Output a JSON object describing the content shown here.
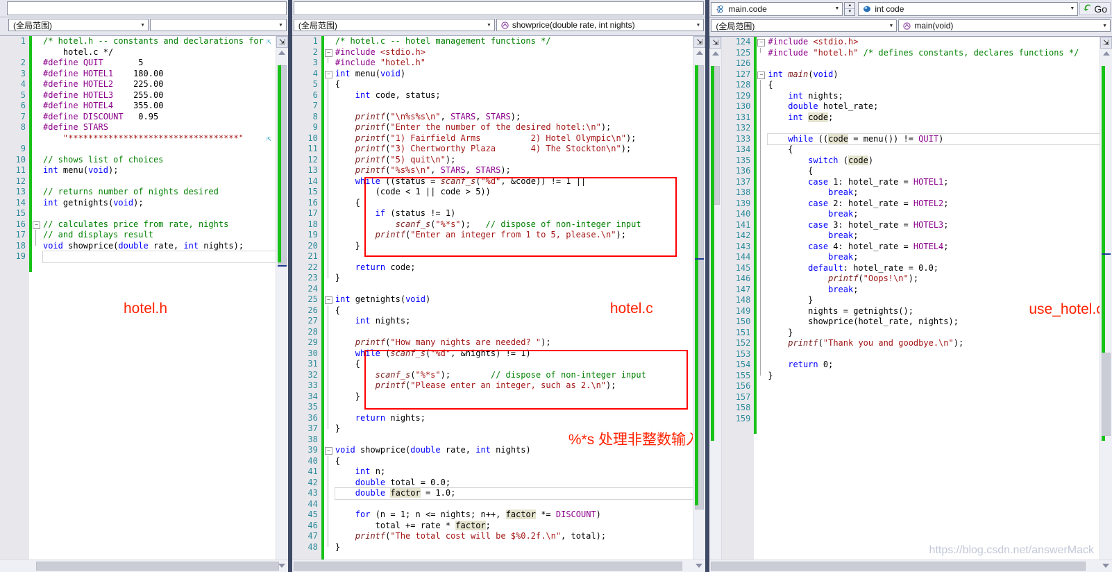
{
  "window": {
    "accent": "#3f4a66",
    "annotation_color": "#ff2200",
    "changebar_color": "#19c219",
    "watermark": "https://blog.csdn.net/answerMack"
  },
  "panes": [
    {
      "id": "hotel-h",
      "annotation": "hotel.h",
      "scope_combo": {
        "value": "(全局范围)",
        "icon": "none"
      },
      "member_combo": {
        "value": "",
        "icon": "none"
      },
      "first_line": 1,
      "lines": [
        {
          "n": 1,
          "text": "/* hotel.h -- constants and declarations for",
          "kind": "cmt",
          "fold": "none"
        },
        {
          "n": "",
          "text": "    hotel.c */",
          "kind": "cmt",
          "fold": "none"
        },
        {
          "n": 2,
          "text": "#define QUIT       5",
          "kind": "pp",
          "fold": "none"
        },
        {
          "n": 3,
          "text": "#define HOTEL1    180.00",
          "kind": "pp",
          "fold": "none"
        },
        {
          "n": 4,
          "text": "#define HOTEL2    225.00",
          "kind": "pp",
          "fold": "none"
        },
        {
          "n": 5,
          "text": "#define HOTEL3    255.00",
          "kind": "pp",
          "fold": "none"
        },
        {
          "n": 6,
          "text": "#define HOTEL4    355.00",
          "kind": "pp",
          "fold": "none"
        },
        {
          "n": 7,
          "text": "#define DISCOUNT   0.95",
          "kind": "pp",
          "fold": "none"
        },
        {
          "n": 8,
          "text": "#define STARS",
          "kind": "pp",
          "fold": "none"
        },
        {
          "n": "",
          "text": "    \"**********************************\"",
          "kind": "str",
          "fold": "none"
        },
        {
          "n": 9,
          "text": "",
          "kind": "plain",
          "fold": "none"
        },
        {
          "n": 10,
          "text": "// shows list of choices",
          "kind": "cmt",
          "fold": "none"
        },
        {
          "n": 11,
          "text": "int menu(void);",
          "kind": "decl",
          "fold": "none"
        },
        {
          "n": 12,
          "text": "",
          "kind": "plain",
          "fold": "none"
        },
        {
          "n": 13,
          "text": "// returns number of nights desired",
          "kind": "cmt",
          "fold": "none"
        },
        {
          "n": 14,
          "text": "int getnights(void);",
          "kind": "decl",
          "fold": "none"
        },
        {
          "n": 15,
          "text": "",
          "kind": "plain",
          "fold": "none"
        },
        {
          "n": 16,
          "text": "// calculates price from rate, nights",
          "kind": "cmt",
          "fold": "minus"
        },
        {
          "n": 17,
          "text": "// and displays result",
          "kind": "cmt",
          "fold": "bar"
        },
        {
          "n": 18,
          "text": "void showprice(double rate, int nights);",
          "kind": "decl",
          "fold": "end"
        },
        {
          "n": 19,
          "text": "",
          "kind": "plain",
          "fold": "none",
          "current": true
        }
      ]
    },
    {
      "id": "hotel-c",
      "annotation": "hotel.c",
      "annotation2": "%*s  处理非整数输入",
      "scope_combo": {
        "value": "(全局范围)",
        "icon": "none"
      },
      "member_combo": {
        "value": "showprice(double rate, int nights)",
        "icon": "method-icon"
      },
      "first_line": 1,
      "lines": [
        {
          "n": 1,
          "text": "/* hotel.c -- hotel management functions */",
          "kind": "cmt"
        },
        {
          "n": 2,
          "text": "#include <stdio.h>",
          "kind": "pp",
          "fold": "minus"
        },
        {
          "n": 3,
          "text": "#include \"hotel.h\"",
          "kind": "ppstr",
          "fold": "end"
        },
        {
          "n": 4,
          "text": "int menu(void)",
          "kind": "decl",
          "fold": "minus"
        },
        {
          "n": 5,
          "text": "{",
          "kind": "plain",
          "fold": "bar"
        },
        {
          "n": 6,
          "text": "    int code, status;",
          "kind": "decl",
          "fold": "bar"
        },
        {
          "n": 7,
          "text": "",
          "kind": "plain",
          "fold": "bar"
        },
        {
          "n": 8,
          "text": "    printf(\"\\n%s%s\\n\", STARS, STARS);",
          "kind": "call",
          "fold": "bar"
        },
        {
          "n": 9,
          "text": "    printf(\"Enter the number of the desired hotel:\\n\");",
          "kind": "call",
          "fold": "bar"
        },
        {
          "n": 10,
          "text": "    printf(\"1) Fairfield Arms          2) Hotel Olympic\\n\");",
          "kind": "call",
          "fold": "bar"
        },
        {
          "n": 11,
          "text": "    printf(\"3) Chertworthy Plaza       4) The Stockton\\n\");",
          "kind": "call",
          "fold": "bar"
        },
        {
          "n": 12,
          "text": "    printf(\"5) quit\\n\");",
          "kind": "call",
          "fold": "bar"
        },
        {
          "n": 13,
          "text": "    printf(\"%s%s\\n\", STARS, STARS);",
          "kind": "call",
          "fold": "bar"
        },
        {
          "n": 14,
          "text": "    while ((status = scanf_s(\"%d\", &code)) != 1 ||",
          "kind": "ctrl",
          "fold": "bar"
        },
        {
          "n": 15,
          "text": "        (code < 1 || code > 5))",
          "kind": "plain",
          "fold": "bar"
        },
        {
          "n": 16,
          "text": "    {",
          "kind": "plain",
          "fold": "bar"
        },
        {
          "n": 17,
          "text": "        if (status != 1)",
          "kind": "ctrl",
          "fold": "bar"
        },
        {
          "n": 18,
          "text": "            scanf_s(\"%*s\");   // dispose of non-integer input",
          "kind": "callcmt",
          "fold": "bar"
        },
        {
          "n": 19,
          "text": "        printf(\"Enter an integer from 1 to 5, please.\\n\");",
          "kind": "call",
          "fold": "bar"
        },
        {
          "n": 20,
          "text": "    }",
          "kind": "plain",
          "fold": "bar"
        },
        {
          "n": 21,
          "text": "",
          "kind": "plain",
          "fold": "bar"
        },
        {
          "n": 22,
          "text": "    return code;",
          "kind": "ctrl",
          "fold": "bar"
        },
        {
          "n": 23,
          "text": "}",
          "kind": "plain",
          "fold": "end"
        },
        {
          "n": 24,
          "text": "",
          "kind": "plain"
        },
        {
          "n": 25,
          "text": "int getnights(void)",
          "kind": "decl",
          "fold": "minus"
        },
        {
          "n": 26,
          "text": "{",
          "kind": "plain",
          "fold": "bar"
        },
        {
          "n": 27,
          "text": "    int nights;",
          "kind": "decl",
          "fold": "bar"
        },
        {
          "n": 28,
          "text": "",
          "kind": "plain",
          "fold": "bar"
        },
        {
          "n": 29,
          "text": "    printf(\"How many nights are needed? \");",
          "kind": "call",
          "fold": "bar"
        },
        {
          "n": 30,
          "text": "    while (scanf_s(\"%d\", &nights) != 1)",
          "kind": "ctrl",
          "fold": "bar"
        },
        {
          "n": 31,
          "text": "    {",
          "kind": "plain",
          "fold": "bar"
        },
        {
          "n": 32,
          "text": "        scanf_s(\"%*s\");        // dispose of non-integer input",
          "kind": "callcmt",
          "fold": "bar"
        },
        {
          "n": 33,
          "text": "        printf(\"Please enter an integer, such as 2.\\n\");",
          "kind": "call",
          "fold": "bar"
        },
        {
          "n": 34,
          "text": "    }",
          "kind": "plain",
          "fold": "bar"
        },
        {
          "n": 35,
          "text": "",
          "kind": "plain",
          "fold": "bar"
        },
        {
          "n": 36,
          "text": "    return nights;",
          "kind": "ctrl",
          "fold": "bar"
        },
        {
          "n": 37,
          "text": "}",
          "kind": "plain",
          "fold": "end"
        },
        {
          "n": 38,
          "text": "",
          "kind": "plain"
        },
        {
          "n": 39,
          "text": "void showprice(double rate, int nights)",
          "kind": "decl",
          "fold": "minus"
        },
        {
          "n": 40,
          "text": "{",
          "kind": "plain",
          "fold": "bar"
        },
        {
          "n": 41,
          "text": "    int n;",
          "kind": "decl",
          "fold": "bar"
        },
        {
          "n": 42,
          "text": "    double total = 0.0;",
          "kind": "decl",
          "fold": "bar"
        },
        {
          "n": 43,
          "text": "    double factor = 1.0;",
          "kind": "decl",
          "fold": "bar",
          "current": true
        },
        {
          "n": 44,
          "text": "",
          "kind": "plain",
          "fold": "bar"
        },
        {
          "n": 45,
          "text": "    for (n = 1; n <= nights; n++, factor *= DISCOUNT)",
          "kind": "ctrl",
          "fold": "bar"
        },
        {
          "n": 46,
          "text": "        total += rate * factor;",
          "kind": "plain",
          "fold": "bar"
        },
        {
          "n": 47,
          "text": "    printf(\"The total cost will be $%0.2f.\\n\", total);",
          "kind": "call",
          "fold": "bar"
        },
        {
          "n": 48,
          "text": "}",
          "kind": "plain",
          "fold": "end"
        }
      ]
    },
    {
      "id": "use-hotel-c",
      "annotation": "use_hotel.c",
      "file_combo": {
        "value": "main.code",
        "icon": "code-file-icon"
      },
      "symbol_combo": {
        "value": "int code",
        "icon": "field-icon"
      },
      "go_button": {
        "label": "Go",
        "icon": "go-arrow-icon"
      },
      "scope_combo": {
        "value": "(全局范围)",
        "icon": "none"
      },
      "member_combo": {
        "value": "main(void)",
        "icon": "method-icon"
      },
      "first_line": 124,
      "lines": [
        {
          "n": 124,
          "text": "#include <stdio.h>",
          "kind": "pp",
          "fold": "minus"
        },
        {
          "n": 125,
          "text": "#include \"hotel.h\" /* defines constants, declares functions */",
          "kind": "ppstrcmt",
          "fold": "end"
        },
        {
          "n": 126,
          "text": "",
          "kind": "plain"
        },
        {
          "n": 127,
          "text": "int main(void)",
          "kind": "declmain",
          "fold": "minus"
        },
        {
          "n": 128,
          "text": "{",
          "kind": "plain",
          "fold": "bar"
        },
        {
          "n": 129,
          "text": "    int nights;",
          "kind": "decl",
          "fold": "bar"
        },
        {
          "n": 130,
          "text": "    double hotel_rate;",
          "kind": "decl",
          "fold": "bar"
        },
        {
          "n": 131,
          "text": "    int code;",
          "kind": "declhl",
          "fold": "bar"
        },
        {
          "n": 132,
          "text": "",
          "kind": "plain",
          "fold": "bar"
        },
        {
          "n": 133,
          "text": "    while ((code = menu()) != QUIT)",
          "kind": "ctrlhl",
          "fold": "bar",
          "current": true
        },
        {
          "n": 134,
          "text": "    {",
          "kind": "plain",
          "fold": "bar"
        },
        {
          "n": 135,
          "text": "        switch (code)",
          "kind": "ctrlhl2",
          "fold": "bar"
        },
        {
          "n": 136,
          "text": "        {",
          "kind": "plain",
          "fold": "bar"
        },
        {
          "n": 137,
          "text": "        case 1: hotel_rate = HOTEL1;",
          "kind": "case",
          "fold": "bar"
        },
        {
          "n": 138,
          "text": "            break;",
          "kind": "ctrl",
          "fold": "bar"
        },
        {
          "n": 139,
          "text": "        case 2: hotel_rate = HOTEL2;",
          "kind": "case",
          "fold": "bar"
        },
        {
          "n": 140,
          "text": "            break;",
          "kind": "ctrl",
          "fold": "bar"
        },
        {
          "n": 141,
          "text": "        case 3: hotel_rate = HOTEL3;",
          "kind": "case",
          "fold": "bar"
        },
        {
          "n": 142,
          "text": "            break;",
          "kind": "ctrl",
          "fold": "bar"
        },
        {
          "n": 143,
          "text": "        case 4: hotel_rate = HOTEL4;",
          "kind": "case",
          "fold": "bar"
        },
        {
          "n": 144,
          "text": "            break;",
          "kind": "ctrl",
          "fold": "bar"
        },
        {
          "n": 145,
          "text": "        default: hotel_rate = 0.0;",
          "kind": "case",
          "fold": "bar"
        },
        {
          "n": 146,
          "text": "            printf(\"Oops!\\n\");",
          "kind": "call",
          "fold": "bar"
        },
        {
          "n": 147,
          "text": "            break;",
          "kind": "ctrl",
          "fold": "bar"
        },
        {
          "n": 148,
          "text": "        }",
          "kind": "plain",
          "fold": "bar"
        },
        {
          "n": 149,
          "text": "        nights = getnights();",
          "kind": "plain",
          "fold": "bar"
        },
        {
          "n": 150,
          "text": "        showprice(hotel_rate, nights);",
          "kind": "plain",
          "fold": "bar"
        },
        {
          "n": 151,
          "text": "    }",
          "kind": "plain",
          "fold": "bar"
        },
        {
          "n": 152,
          "text": "    printf(\"Thank you and goodbye.\\n\");",
          "kind": "call",
          "fold": "bar"
        },
        {
          "n": 153,
          "text": "",
          "kind": "plain",
          "fold": "bar"
        },
        {
          "n": 154,
          "text": "    return 0;",
          "kind": "ctrl",
          "fold": "bar"
        },
        {
          "n": 155,
          "text": "}",
          "kind": "plain",
          "fold": "end"
        },
        {
          "n": 156,
          "text": "",
          "kind": "plain"
        },
        {
          "n": 157,
          "text": "",
          "kind": "plain"
        },
        {
          "n": 158,
          "text": "",
          "kind": "plain"
        },
        {
          "n": 159,
          "text": "",
          "kind": "plain"
        }
      ]
    }
  ]
}
